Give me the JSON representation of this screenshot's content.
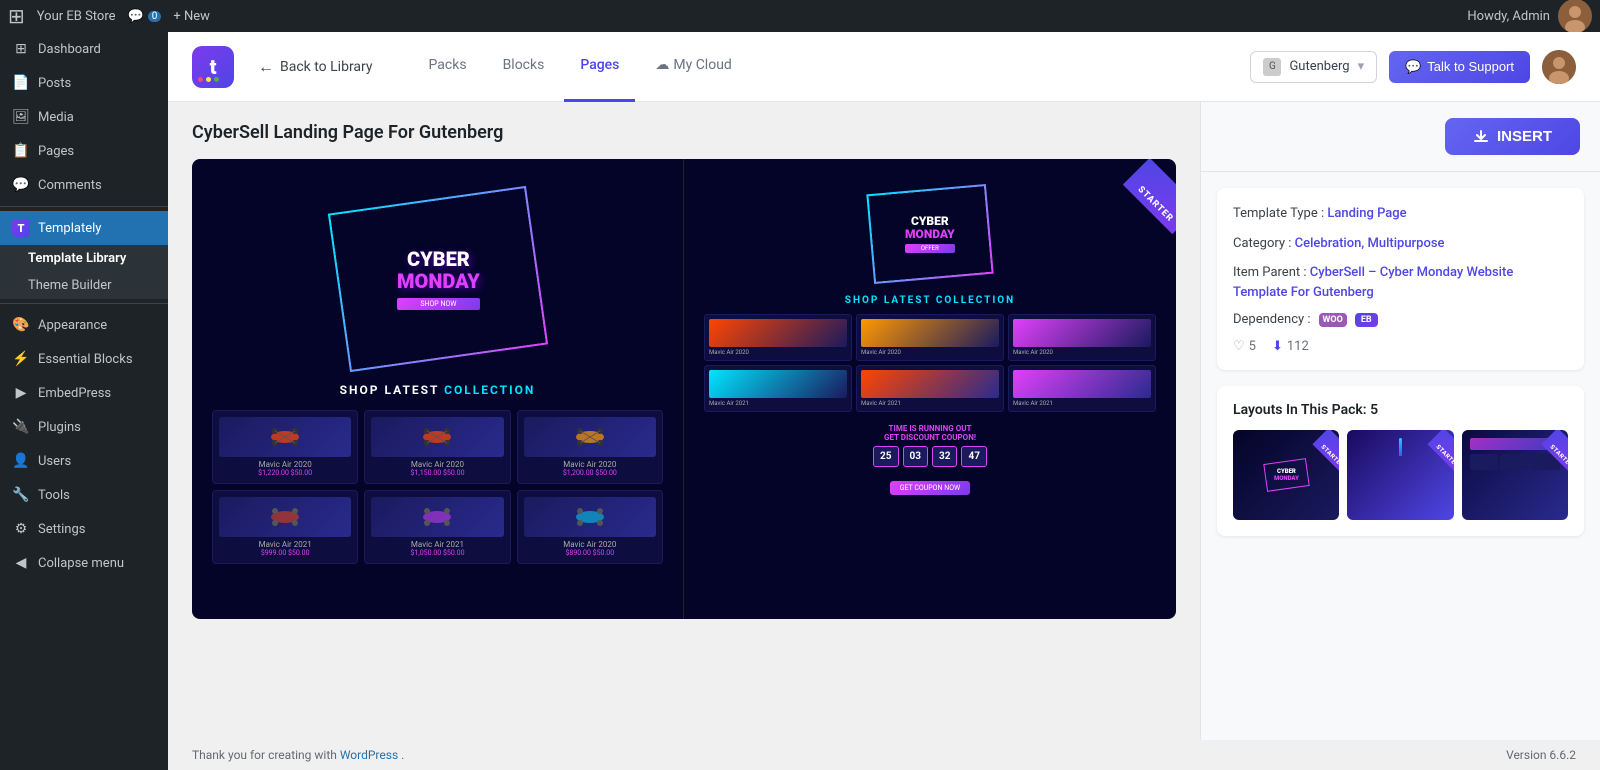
{
  "adminBar": {
    "logo": "W",
    "siteName": "Your EB Store",
    "commentCount": "0",
    "newLabel": "+ New",
    "howdy": "Howdy, Admin"
  },
  "sidebar": {
    "items": [
      {
        "id": "dashboard",
        "label": "Dashboard",
        "icon": "⊞"
      },
      {
        "id": "posts",
        "label": "Posts",
        "icon": "📄"
      },
      {
        "id": "media",
        "label": "Media",
        "icon": "🖼"
      },
      {
        "id": "pages",
        "label": "Pages",
        "icon": "📋"
      },
      {
        "id": "comments",
        "label": "Comments",
        "icon": "💬"
      },
      {
        "id": "templately",
        "label": "Templately",
        "icon": "T",
        "active": true
      },
      {
        "id": "appearance",
        "label": "Appearance",
        "icon": "🎨"
      },
      {
        "id": "essential-blocks",
        "label": "Essential Blocks",
        "icon": "⚡"
      },
      {
        "id": "embedpress",
        "label": "EmbedPress",
        "icon": "▶"
      },
      {
        "id": "plugins",
        "label": "Plugins",
        "icon": "🔌"
      },
      {
        "id": "users",
        "label": "Users",
        "icon": "👤"
      },
      {
        "id": "tools",
        "label": "Tools",
        "icon": "🔧"
      },
      {
        "id": "settings",
        "label": "Settings",
        "icon": "⚙"
      },
      {
        "id": "collapse",
        "label": "Collapse menu",
        "icon": "◀"
      }
    ],
    "subItems": [
      {
        "id": "template-library",
        "label": "Template Library",
        "active": true
      },
      {
        "id": "theme-builder",
        "label": "Theme Builder"
      }
    ]
  },
  "header": {
    "backLabel": "Back to Library",
    "tabs": [
      {
        "id": "packs",
        "label": "Packs"
      },
      {
        "id": "blocks",
        "label": "Blocks"
      },
      {
        "id": "pages",
        "label": "Pages",
        "active": true
      },
      {
        "id": "my-cloud",
        "label": "My Cloud",
        "icon": "☁"
      }
    ],
    "gutenbergLabel": "Gutenberg",
    "talkToSupport": "Talk to Support"
  },
  "templateDetail": {
    "title": "CyberSell Landing Page For Gutenberg",
    "ribbon": "STARTER",
    "insertLabel": "INSERT",
    "info": {
      "templateType": {
        "label": "Template Type : ",
        "value": "Landing Page"
      },
      "category": {
        "label": "Category : ",
        "value": "Celebration, Multipurpose"
      },
      "itemParent": {
        "label": "Item Parent : ",
        "value": "CyberSell – Cyber Monday Website Template For Gutenberg"
      },
      "dependency": {
        "label": "Dependency : "
      }
    },
    "likes": "5",
    "downloads": "112",
    "layouts": {
      "title": "Layouts In This Pack: 5"
    }
  },
  "footer": {
    "thankYouText": "Thank you for creating with ",
    "wordpressLink": "WordPress",
    "versionText": "Version 6.6.2"
  }
}
